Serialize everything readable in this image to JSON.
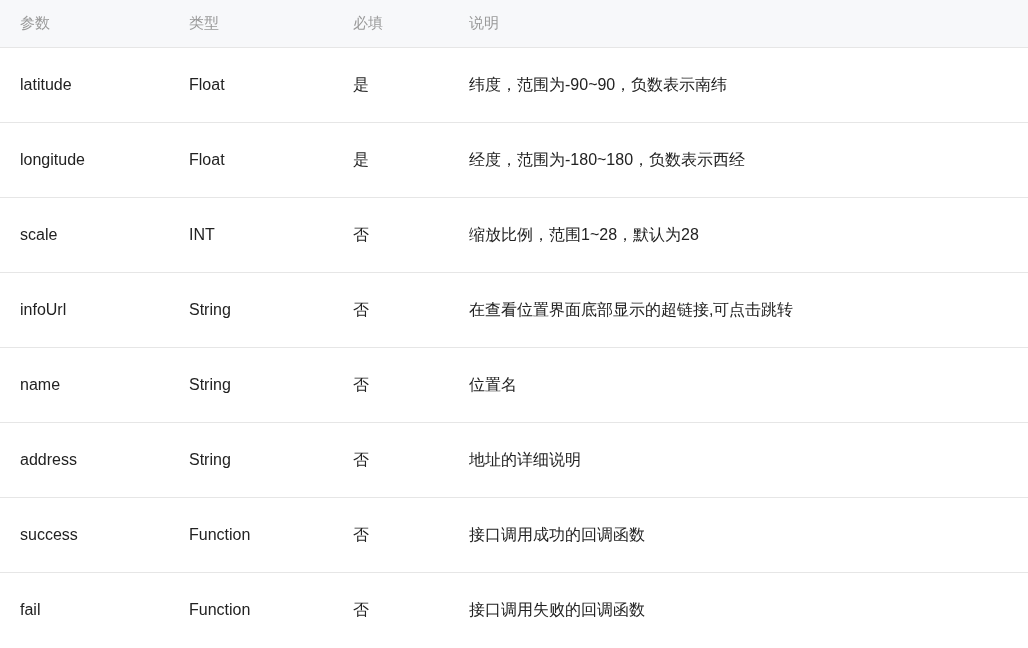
{
  "table": {
    "columns": [
      "参数",
      "类型",
      "必填",
      "说明"
    ],
    "rows": [
      [
        "latitude",
        "Float",
        "是",
        "纬度，范围为-90~90，负数表示南纬"
      ],
      [
        "longitude",
        "Float",
        "是",
        "经度，范围为-180~180，负数表示西经"
      ],
      [
        "scale",
        "INT",
        "否",
        "缩放比例，范围1~28，默认为28"
      ],
      [
        "infoUrl",
        "String",
        "否",
        "在查看位置界面底部显示的超链接,可点击跳转"
      ],
      [
        "name",
        "String",
        "否",
        "位置名"
      ],
      [
        "address",
        "String",
        "否",
        "地址的详细说明"
      ],
      [
        "success",
        "Function",
        "否",
        "接口调用成功的回调函数"
      ],
      [
        "fail",
        "Function",
        "否",
        "接口调用失败的回调函数"
      ]
    ]
  }
}
